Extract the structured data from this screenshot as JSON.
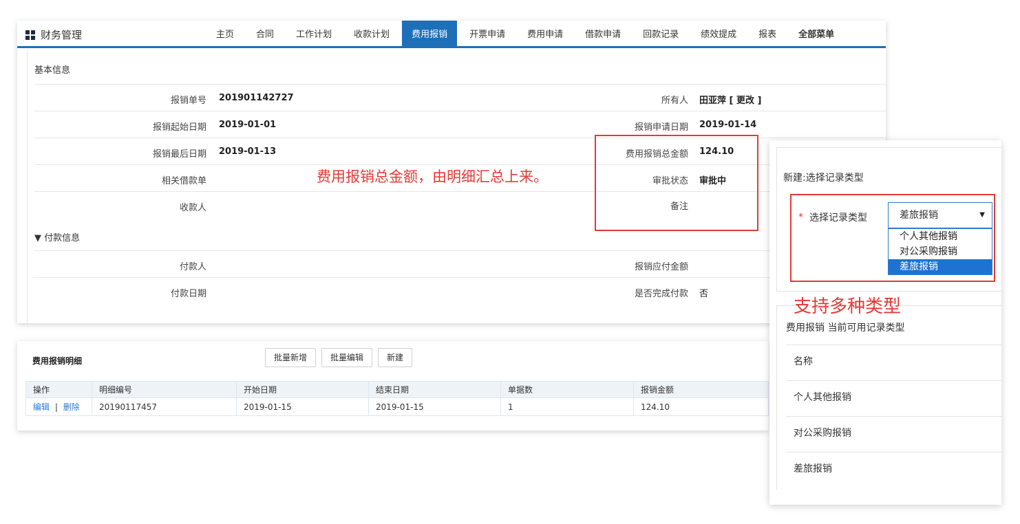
{
  "header": {
    "app_title": "财务管理",
    "tabs": [
      {
        "label": "主页"
      },
      {
        "label": "合同"
      },
      {
        "label": "工作计划"
      },
      {
        "label": "收款计划"
      },
      {
        "label": "费用报销"
      },
      {
        "label": "开票申请"
      },
      {
        "label": "费用申请"
      },
      {
        "label": "借款申请"
      },
      {
        "label": "回款记录"
      },
      {
        "label": "绩效提成"
      },
      {
        "label": "报表"
      },
      {
        "label": "全部菜单"
      }
    ],
    "active_tab": "费用报销"
  },
  "basic_info": {
    "title": "基本信息",
    "rows": [
      {
        "label1": "报销单号",
        "value1": "201901142727",
        "label2": "所有人",
        "value2": "田亚萍",
        "value2_link": "[ 更改 ]"
      },
      {
        "label1": "报销起始日期",
        "value1": "2019-01-01",
        "label2": "报销申请日期",
        "value2": "2019-01-14"
      },
      {
        "label1": "报销最后日期",
        "value1": "2019-01-13",
        "label2": "费用报销总金额",
        "value2": "124.10"
      },
      {
        "label1": "相关借款单",
        "value1": "",
        "label2": "审批状态",
        "value2": "审批中"
      },
      {
        "label1": "收款人",
        "value1": "",
        "label2": "备注",
        "value2": ""
      }
    ]
  },
  "payment_info": {
    "title": "▼ 付款信息",
    "rows": [
      {
        "label1": "付款人",
        "value1": "",
        "label2": "报销应付金额",
        "value2": ""
      },
      {
        "label1": "付款日期",
        "value1": "",
        "label2": "是否完成付款",
        "value2": "否"
      }
    ]
  },
  "annotations": {
    "total_note": "费用报销总金额，由明细汇总上来。",
    "types_note": "支持多种类型"
  },
  "detail": {
    "title": "费用报销明细",
    "buttons": {
      "batch_add": "批量新增",
      "batch_edit": "批量编辑",
      "new": "新建"
    },
    "columns": [
      "操作",
      "明细编号",
      "开始日期",
      "结束日期",
      "单据数",
      "报销金额"
    ],
    "rows": [
      {
        "edit": "编辑",
        "sep": "|",
        "delete": "删除",
        "id": "20190117457",
        "start": "2019-01-15",
        "end": "2019-01-15",
        "count": "1",
        "amount": "124.10"
      }
    ]
  },
  "side": {
    "new_title": "新建:选择记录类型",
    "required_mark": "*",
    "select_label": "选择记录类型",
    "selected_value": "差旅报销",
    "options": [
      "个人其他报销",
      "对公采购报销",
      "差旅报销"
    ],
    "available_title": "费用报销 当前可用记录类型",
    "types_header": "名称",
    "types": [
      "个人其他报销",
      "对公采购报销",
      "差旅报销"
    ]
  },
  "colors": {
    "accent": "#1d6fb8",
    "annotation": "#e53935",
    "link": "#2a7bd0"
  }
}
